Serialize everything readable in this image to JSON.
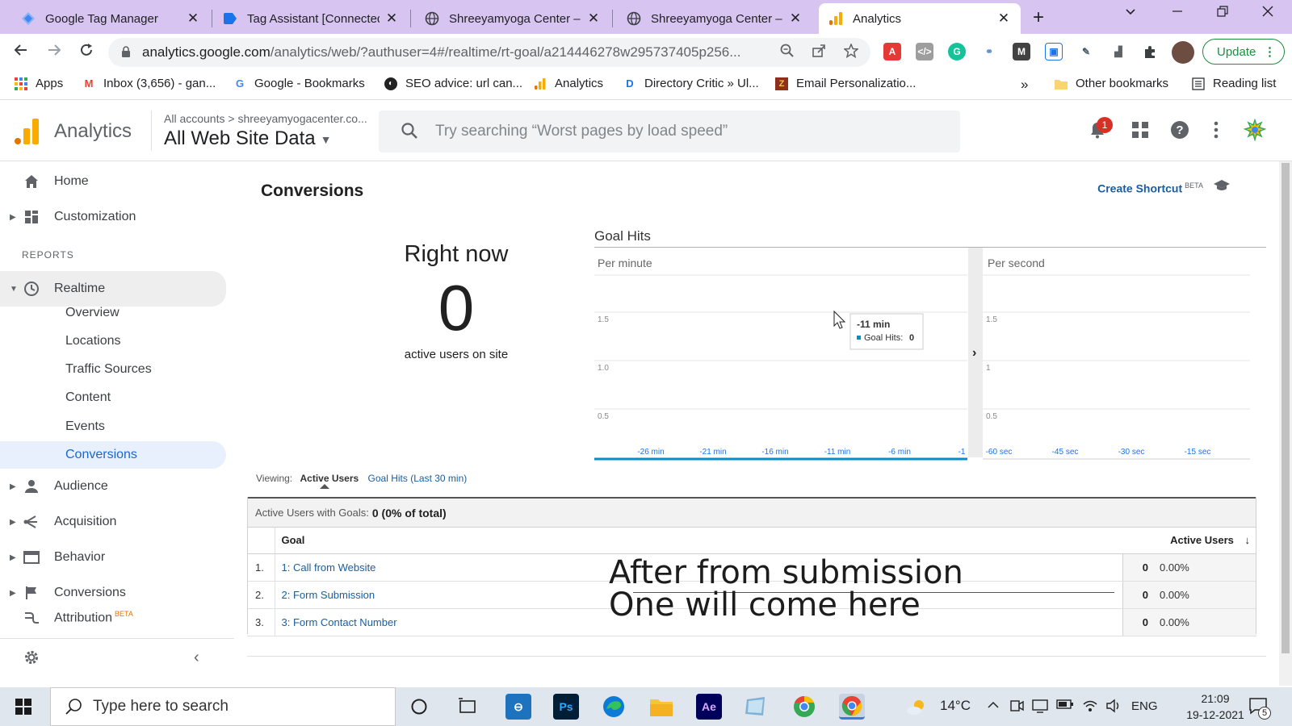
{
  "browser": {
    "tabs": [
      {
        "title": "Google Tag Manager",
        "icon": "gtm-icon"
      },
      {
        "title": "Tag Assistant [Connected]",
        "icon": "tag-assistant-icon"
      },
      {
        "title": "Shreeyamyoga Center – B",
        "icon": "globe-icon"
      },
      {
        "title": "Shreeyamyoga Center – B",
        "icon": "globe-icon"
      },
      {
        "title": "Analytics",
        "icon": "analytics-icon"
      }
    ],
    "close_glyph": "✕",
    "new_tab_glyph": "+",
    "url_host": "analytics.google.com",
    "url_path": "/analytics/web/?authuser=4#/realtime/rt-goal/a214446278w295737405p256...",
    "update_label": "Update",
    "bookmarks": [
      {
        "label": "Apps",
        "icon": "apps-grid-icon"
      },
      {
        "label": "Inbox (3,656) - gan...",
        "icon": "gmail-icon"
      },
      {
        "label": "Google - Bookmarks",
        "icon": "google-icon"
      },
      {
        "label": "SEO advice: url can...",
        "icon": "seo-icon"
      },
      {
        "label": "Analytics",
        "icon": "analytics-icon"
      },
      {
        "label": "Directory Critic » Ul...",
        "icon": "directory-icon"
      },
      {
        "label": "Email Personalizatio...",
        "icon": "zoho-icon"
      }
    ],
    "bookmarks_overflow": "»",
    "other_bookmarks": "Other bookmarks",
    "reading_list": "Reading list"
  },
  "ga": {
    "product": "Analytics",
    "breadcrumb": "All accounts > shreeyamyogacenter.co...",
    "view": "All Web Site Data",
    "search_placeholder": "Try searching “Worst pages by load speed”",
    "notification_count": "1",
    "accent_color": "#f9ab00"
  },
  "nav": {
    "home": "Home",
    "customization": "Customization",
    "reports_header": "REPORTS",
    "realtime": "Realtime",
    "realtime_sub": [
      "Overview",
      "Locations",
      "Traffic Sources",
      "Content",
      "Events",
      "Conversions"
    ],
    "audience": "Audience",
    "acquisition": "Acquisition",
    "behavior": "Behavior",
    "conversions": "Conversions",
    "attribution": "Attribution",
    "beta": "BETA",
    "collapse_glyph": "‹"
  },
  "page": {
    "title": "Conversions",
    "create_shortcut": "Create Shortcut",
    "beta": "BETA",
    "right_now_label": "Right now",
    "right_now_value": "0",
    "right_now_sub": "active users on site",
    "goal_hits_title": "Goal Hits",
    "per_minute": "Per minute",
    "per_second": "Per second",
    "expand_glyph": "›",
    "tooltip_title": "-11 min",
    "tooltip_series": "Goal Hits:",
    "tooltip_value": "0",
    "viewing_label": "Viewing:",
    "viewing_tab_active": "Active Users",
    "viewing_tab_other": "Goal Hits (Last 30 min)",
    "summary_label": "Active Users with Goals:",
    "summary_value": "0 (0% of total)",
    "table_header_goal": "Goal",
    "table_header_users": "Active Users",
    "sort_glyph": "↓",
    "rows": [
      {
        "num": "1.",
        "goal": "1: Call from Website",
        "users": "0",
        "pct": "0.00%"
      },
      {
        "num": "2.",
        "goal": "2: Form Submission",
        "users": "0",
        "pct": "0.00%"
      },
      {
        "num": "3.",
        "goal": "3: Form Contact Number",
        "users": "0",
        "pct": "0.00%"
      }
    ],
    "overlay_line1": "After from submission",
    "overlay_line2": "One will come here"
  },
  "chart_data": [
    {
      "type": "bar",
      "title": "Per minute",
      "categories": [
        "-26 min",
        "-21 min",
        "-16 min",
        "-11 min",
        "-6 min",
        "-1"
      ],
      "y_ticks": [
        "1.5",
        "1.0",
        "0.5"
      ],
      "series": [
        {
          "name": "Goal Hits",
          "values": [
            0,
            0,
            0,
            0,
            0,
            0
          ]
        }
      ],
      "ylim": [
        0,
        2
      ],
      "grid": true
    },
    {
      "type": "bar",
      "title": "Per second",
      "categories": [
        "-60 sec",
        "-45 sec",
        "-30 sec",
        "-15 sec"
      ],
      "y_ticks": [
        "1.5",
        "1",
        "0.5"
      ],
      "series": [
        {
          "name": "Goal Hits",
          "values": [
            0,
            0,
            0,
            0
          ]
        }
      ],
      "ylim": [
        0,
        2
      ],
      "grid": true
    }
  ],
  "taskbar": {
    "search_placeholder": "Type here to search",
    "temperature": "14°C",
    "language": "ENG",
    "time": "21:09",
    "date": "19-12-2021",
    "notification_count": "5"
  }
}
